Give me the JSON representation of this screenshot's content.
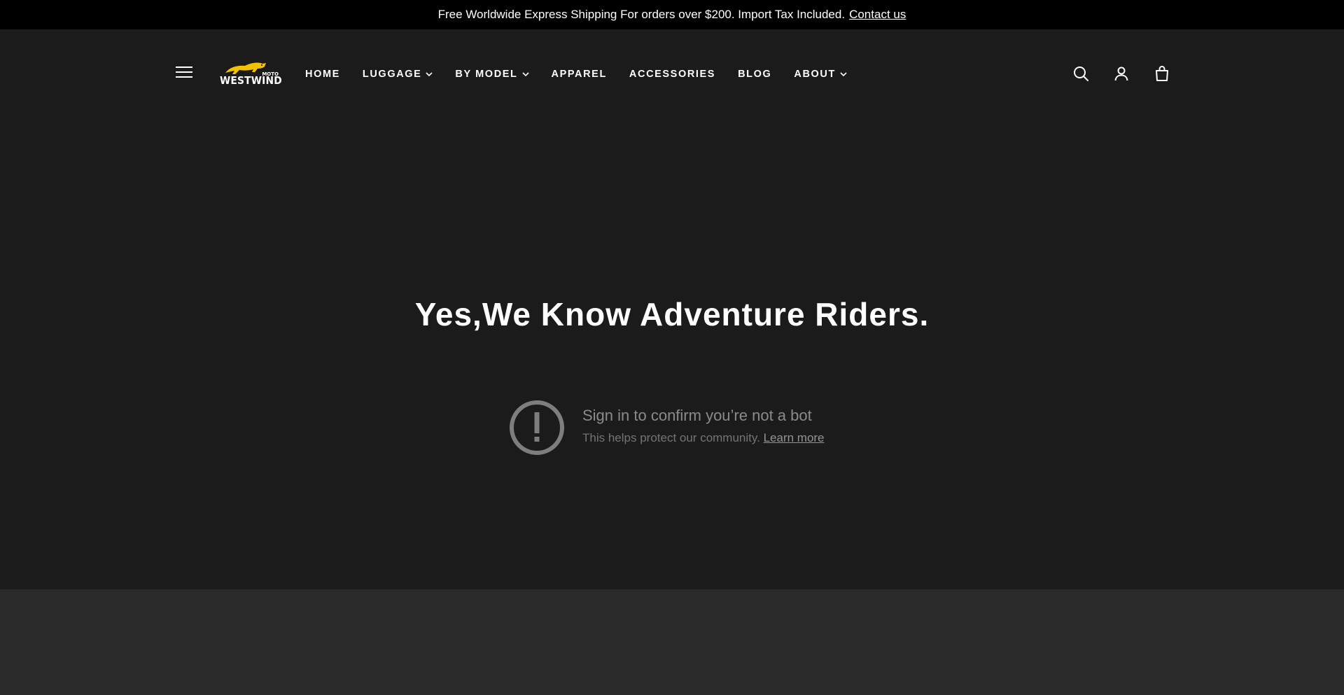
{
  "announcement": {
    "text": "Free Worldwide Express Shipping For orders over $200. Import Tax Included.",
    "link_label": "Contact us"
  },
  "logo": {
    "moto": "MOTO",
    "wordmark": "WESTWIND"
  },
  "nav": {
    "items": [
      {
        "label": "HOME",
        "has_dropdown": false
      },
      {
        "label": "LUGGAGE",
        "has_dropdown": true
      },
      {
        "label": "BY MODEL",
        "has_dropdown": true
      },
      {
        "label": "APPAREL",
        "has_dropdown": false
      },
      {
        "label": "ACCESSORIES",
        "has_dropdown": false
      },
      {
        "label": "BLOG",
        "has_dropdown": false
      },
      {
        "label": "ABOUT",
        "has_dropdown": true
      }
    ]
  },
  "header_icons": [
    "search-icon",
    "account-icon",
    "cart-icon"
  ],
  "hero": {
    "title": "Yes,We Know Adventure Riders."
  },
  "video_overlay": {
    "title": "Sign in to confirm you’re not a bot",
    "subtitle": "This helps protect our community.",
    "link_label": "Learn more"
  },
  "colors": {
    "announcement_bg": "#000000",
    "header_bg": "#1b1b1b",
    "hero_bg": "#1b1b1b",
    "footer_bg": "#2a2a2a",
    "logo_accent": "#f2c200"
  }
}
